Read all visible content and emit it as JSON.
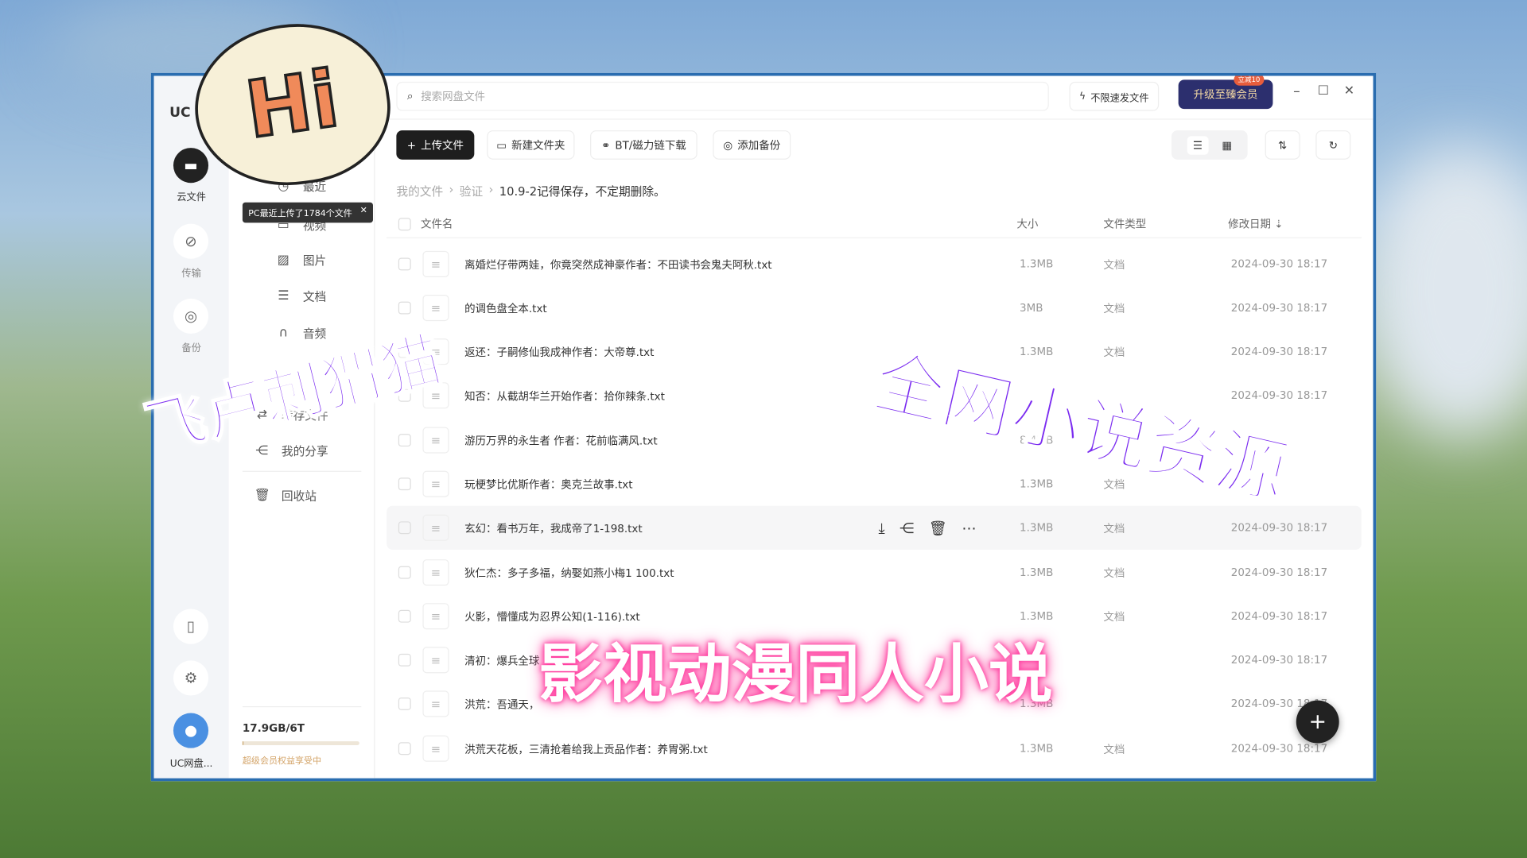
{
  "window": {
    "logo": "UC",
    "search_placeholder": "搜索网盘文件",
    "fast_send": "不限速发文件",
    "upgrade": "升级至臻会员",
    "upgrade_badge": "立减10",
    "controls": {
      "min": "–",
      "max": "☐",
      "close": "✕"
    }
  },
  "rail": {
    "items": [
      {
        "label": "云文件",
        "icon": "folder-icon"
      },
      {
        "label": "传输",
        "icon": "transfer-icon"
      },
      {
        "label": "备份",
        "icon": "backup-icon"
      }
    ],
    "user": "UC网盘..."
  },
  "nav": {
    "items": [
      {
        "label": "最近",
        "icon": "clock-icon"
      },
      {
        "label": "视频",
        "icon": "video-icon"
      },
      {
        "label": "图片",
        "icon": "image-icon"
      },
      {
        "label": "文档",
        "icon": "doc-icon"
      },
      {
        "label": "音频",
        "icon": "headphones-icon"
      },
      {
        "label": "转存文件",
        "icon": "transfer-icon"
      },
      {
        "label": "我的分享",
        "icon": "share-icon"
      },
      {
        "label": "回收站",
        "icon": "trash-icon"
      }
    ],
    "tooltip": "PC最近上传了1784个文件",
    "storage": "17.9GB/6T",
    "storage_used": 0.003,
    "vip_note": "超级会员权益享受中"
  },
  "toolbar": {
    "upload": "上传文件",
    "new_folder": "新建文件夹",
    "bt": "BT/磁力链下载",
    "backup": "添加备份"
  },
  "breadcrumb": [
    "我的文件",
    "验证",
    "10.9-2记得保存，不定期删除。"
  ],
  "columns": {
    "name": "文件名",
    "size": "大小",
    "type": "文件类型",
    "date": "修改日期"
  },
  "files": [
    {
      "name": "离婚烂仔带两娃，你竟突然成神豪作者：不田读书会鬼夫阿秋.txt",
      "size": "1.3MB",
      "type": "文档",
      "date": "2024-09-30 18:17"
    },
    {
      "name": "的调色盘全本.txt",
      "size": "3MB",
      "type": "文档",
      "date": "2024-09-30 18:17"
    },
    {
      "name": "返还：子嗣修仙我成神作者：大帝尊.txt",
      "size": "1.3MB",
      "type": "文档",
      "date": "2024-09-30 18:17"
    },
    {
      "name": "知否：从截胡华兰开始作者：拾你辣条.txt",
      "size": "",
      "type": "",
      "date": "2024-09-30 18:17"
    },
    {
      "name": "游历万界的永生者 作者：花前临满风.txt",
      "size": "8.4MB",
      "type": "",
      "date": ""
    },
    {
      "name": "玩梗梦比优斯作者：奥克兰故事.txt",
      "size": "1.3MB",
      "type": "文档",
      "date": ""
    },
    {
      "name": "玄幻：看书万年，我成帝了1-198.txt",
      "size": "1.3MB",
      "type": "文档",
      "date": "2024-09-30 18:17"
    },
    {
      "name": "狄仁杰：多子多福，纳娶如燕小梅1 100.txt",
      "size": "1.3MB",
      "type": "文档",
      "date": "2024-09-30 18:17"
    },
    {
      "name": "火影，懵懂成为忍界公知(1-116).txt",
      "size": "1.3MB",
      "type": "文档",
      "date": "2024-09-30 18:17"
    },
    {
      "name": "清初：爆兵全球",
      "size": "",
      "type": "",
      "date": "2024-09-30 18:17"
    },
    {
      "name": "洪荒：吾通天，",
      "size": "1.3MB",
      "type": "",
      "date": "2024-09-30 18:17"
    },
    {
      "name": "洪荒天花板，三清抢着给我上贡品作者：养胃粥.txt",
      "size": "1.3MB",
      "type": "文档",
      "date": "2024-09-30 18:17"
    }
  ],
  "fab": "+",
  "overlays": {
    "hi": "Hi",
    "t1": "飞卢刺猬猫",
    "t2": "全网小说资源",
    "t3": "影视动漫同人小说"
  }
}
